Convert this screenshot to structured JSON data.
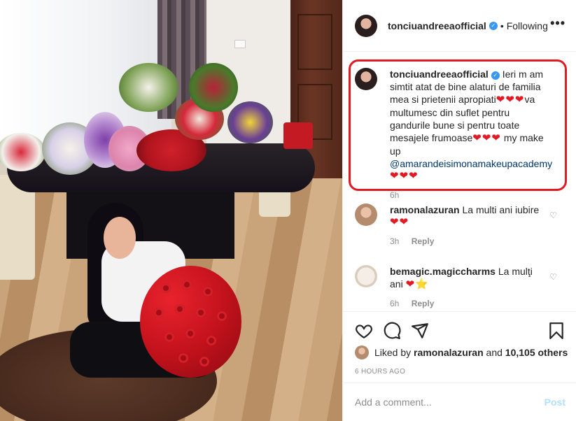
{
  "post": {
    "author": "tonciuandreeaofficial",
    "follow_state": "Following",
    "dot": "•",
    "more": "•••"
  },
  "caption": {
    "author": "tonciuandreeaofficial",
    "text_1": " Ieri m am simtit atat de bine alaturi de familia mea si prietenii apropiati",
    "hearts_1": "❤❤❤",
    "text_2": "va multumesc din suflet pentru gandurile bune si pentru toate mesajele frumoase",
    "hearts_2": "❤❤❤",
    "text_3": " my make up ",
    "mention": "@amarandeisimonamakeupacademy",
    "hearts_3": "❤❤❤",
    "time": "6h"
  },
  "comments": [
    {
      "author": "ramonalazuran",
      "text": "La multi ani iubire",
      "emoji": "❤❤",
      "time": "3h",
      "reply": "Reply"
    },
    {
      "author": "bemagic.magiccharms",
      "text": "La mulţi ani",
      "emoji": "❤",
      "star": "⭐",
      "time": "6h",
      "reply": "Reply"
    }
  ],
  "likes": {
    "prefix": "Liked by ",
    "user": "ramonalazuran",
    "middle": " and ",
    "count": "10,105 others"
  },
  "timestamp": "6 HOURS AGO",
  "comment_box": {
    "placeholder": "Add a comment...",
    "post_label": "Post"
  },
  "colors": {
    "highlight": "#e01b24",
    "verified": "#3897f0",
    "mention": "#00376b",
    "post_disabled": "#b2dffc"
  },
  "icons": [
    "verified-icon",
    "more-options-icon",
    "heart-icon",
    "comment-icon",
    "share-icon",
    "save-icon"
  ]
}
